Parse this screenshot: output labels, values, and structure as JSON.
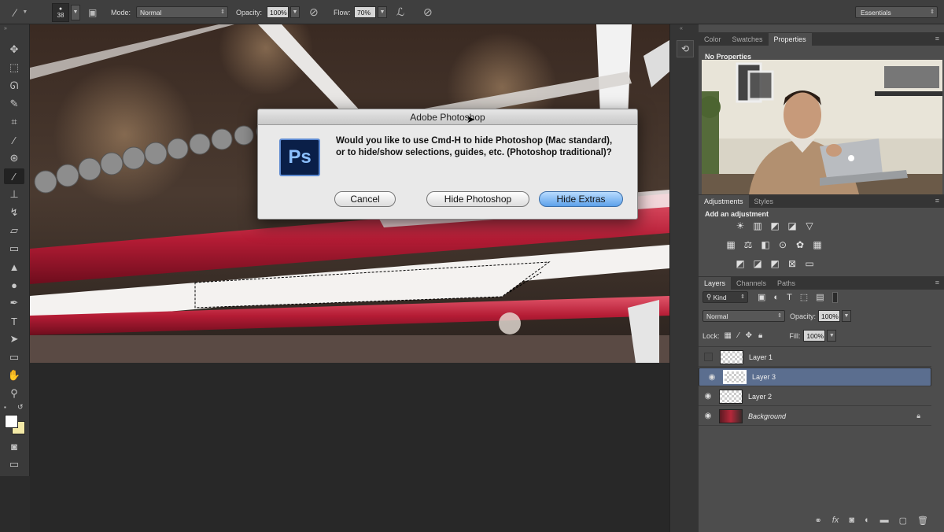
{
  "options_bar": {
    "brush_size": "38",
    "mode_label": "Mode:",
    "mode_value": "Normal",
    "opacity_label": "Opacity:",
    "opacity_value": "100%",
    "flow_label": "Flow:",
    "flow_value": "70%",
    "workspace": "Essentials"
  },
  "dialog": {
    "title": "Adobe Photoshop",
    "icon_text": "Ps",
    "message": "Would you like to use Cmd-H to hide Photoshop (Mac standard), or to hide/show selections, guides, etc. (Photoshop traditional)?",
    "buttons": {
      "cancel": "Cancel",
      "hide_photoshop": "Hide Photoshop",
      "hide_extras": "Hide Extras"
    }
  },
  "top_panel": {
    "tabs": [
      "Color",
      "Swatches",
      "Properties"
    ],
    "active_tab": "Properties",
    "properties_text": "No Properties"
  },
  "adjustments_panel": {
    "tabs": [
      "Adjustments",
      "Styles"
    ],
    "heading": "Add an adjustment",
    "icons_row1": [
      "brightness-contrast",
      "levels",
      "curves",
      "exposure",
      "vibrance"
    ],
    "icons_row2": [
      "hue-saturation",
      "color-balance",
      "black-white",
      "photo-filter",
      "channel-mixer",
      "color-lookup"
    ],
    "icons_row3": [
      "invert",
      "posterize",
      "threshold",
      "selective-color",
      "gradient-map"
    ]
  },
  "layers_panel": {
    "tabs": [
      "Layers",
      "Channels",
      "Paths"
    ],
    "filter_label": "Kind",
    "blend_mode": "Normal",
    "opacity_label": "Opacity:",
    "opacity_value": "100%",
    "lock_label": "Lock:",
    "fill_label": "Fill:",
    "fill_value": "100%",
    "layers": [
      {
        "name": "Layer 1",
        "visible": false,
        "selected": false
      },
      {
        "name": "Layer 3",
        "visible": true,
        "selected": true
      },
      {
        "name": "Layer 2",
        "visible": true,
        "selected": false
      },
      {
        "name": "Background",
        "visible": true,
        "selected": false,
        "locked": true
      }
    ]
  },
  "colors": {
    "foreground": "#ffffff",
    "background": "#f3e9a6",
    "selected_layer": "#5b6e8f",
    "default_button": "#5da1ea"
  }
}
